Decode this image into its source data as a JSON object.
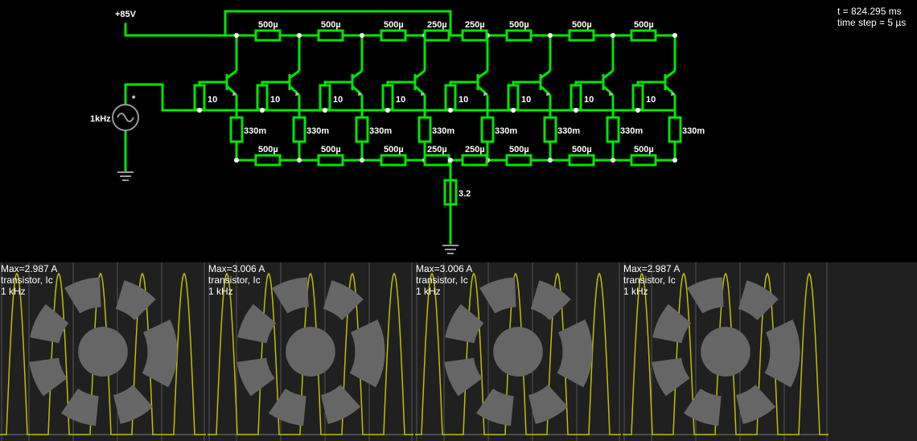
{
  "circuit": {
    "supply_label": "+85V",
    "source_label": "1kHz",
    "source_marker": "*",
    "load_label": "3.2",
    "top_resistor_labels": [
      "500µ",
      "500µ",
      "500µ",
      "250µ",
      "250µ",
      "500µ",
      "500µ",
      "500µ"
    ],
    "bottom_resistor_labels": [
      "500µ",
      "500µ",
      "500µ",
      "250µ",
      "250µ",
      "500µ",
      "500µ",
      "500µ"
    ],
    "base_resistor_labels": [
      "10",
      "10",
      "10",
      "10",
      "10",
      "10",
      "10",
      "10"
    ],
    "emitter_resistor_labels": [
      "330m",
      "330m",
      "330m",
      "330m",
      "330m",
      "330m",
      "330m",
      "330m"
    ],
    "colors": {
      "wire": "#00ff00",
      "wire_dot": "#ffff00",
      "node": "#ffffff",
      "ground": "#808080",
      "trace": "#bfbf00"
    }
  },
  "scopes": [
    {
      "max": "Max=2.987 A",
      "label": "transistor, Ic",
      "freq": "1 kHz",
      "icon": "gear-icon"
    },
    {
      "max": "Max=3.006 A",
      "label": "transistor, Ic",
      "freq": "1 kHz",
      "icon": "gear-icon"
    },
    {
      "max": "Max=3.006 A",
      "label": "transistor, Ic",
      "freq": "1 kHz",
      "icon": "gear-icon"
    },
    {
      "max": "Max=2.987 A",
      "label": "transistor, Ic",
      "freq": "1 kHz",
      "icon": "gear-icon"
    }
  ],
  "sim": {
    "time": "t = 824.295 ms",
    "timestep": "time step = 5 µs"
  }
}
